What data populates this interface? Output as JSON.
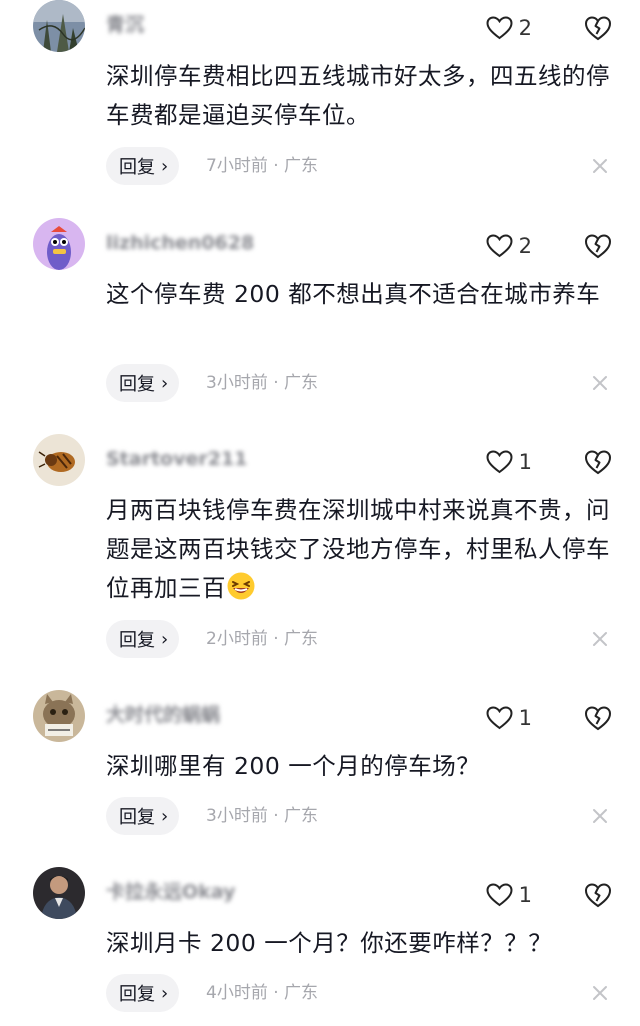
{
  "labels": {
    "reply": "回复",
    "reply_chevron": "›"
  },
  "comments": [
    {
      "username": "青沉",
      "likes": "2",
      "text": "深圳停车费相比四五线城市好太多，四五线的停车费都是逼迫买停车位。",
      "meta": "7小时前 · 广东"
    },
    {
      "username": "lizhichen0628",
      "likes": "2",
      "text": "这个停车费 200 都不想出真不适合在城市养车",
      "meta": "3小时前 · 广东"
    },
    {
      "username": "Startover211",
      "likes": "1",
      "text": "月两百块钱停车费在深圳城中村来说真不贵，问题是这两百块钱交了没地方停车，村里私人停车位再加三百",
      "emoji": "laughing-emoji",
      "meta": "2小时前 · 广东"
    },
    {
      "username": "大时代的蜗蜗",
      "likes": "1",
      "text": "深圳哪里有 200 一个月的停车场？",
      "meta": "3小时前 · 广东"
    },
    {
      "username": "卡拉永远Okay",
      "likes": "1",
      "text": "深圳月卡 200 一个月？你还要咋样？？？",
      "meta": "4小时前 · 广东"
    }
  ],
  "icons": {
    "like": "heart-outline-icon",
    "dislike": "broken-heart-icon",
    "close": "close-icon"
  },
  "colors": {
    "text": "#161823",
    "meta": "#a6a7ad",
    "reply_bg": "#f2f2f4"
  }
}
